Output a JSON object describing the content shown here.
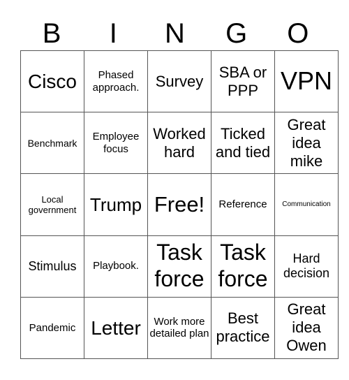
{
  "header": [
    "B",
    "I",
    "N",
    "G",
    "O"
  ],
  "rows": [
    [
      {
        "t": "Cisco",
        "s": 28
      },
      {
        "t": "Phased approach.",
        "s": 15
      },
      {
        "t": "Survey",
        "s": 22
      },
      {
        "t": "SBA or PPP",
        "s": 22
      },
      {
        "t": "VPN",
        "s": 36
      }
    ],
    [
      {
        "t": "Benchmark",
        "s": 14
      },
      {
        "t": "Employee focus",
        "s": 15
      },
      {
        "t": "Worked hard",
        "s": 22
      },
      {
        "t": "Ticked and tied",
        "s": 22
      },
      {
        "t": "Great idea mike",
        "s": 22
      }
    ],
    [
      {
        "t": "Local government",
        "s": 13
      },
      {
        "t": "Trump",
        "s": 26
      },
      {
        "t": "Free!",
        "s": 31
      },
      {
        "t": "Reference",
        "s": 15
      },
      {
        "t": "Communication",
        "s": 10
      }
    ],
    [
      {
        "t": "Stimulus",
        "s": 18
      },
      {
        "t": "Playbook.",
        "s": 15
      },
      {
        "t": "Task force",
        "s": 32
      },
      {
        "t": "Task force",
        "s": 32
      },
      {
        "t": "Hard decision",
        "s": 18
      }
    ],
    [
      {
        "t": "Pandemic",
        "s": 15
      },
      {
        "t": "Letter",
        "s": 28
      },
      {
        "t": "Work more detailed plan",
        "s": 15
      },
      {
        "t": "Best practice",
        "s": 22
      },
      {
        "t": "Great idea Owen",
        "s": 22
      }
    ]
  ]
}
